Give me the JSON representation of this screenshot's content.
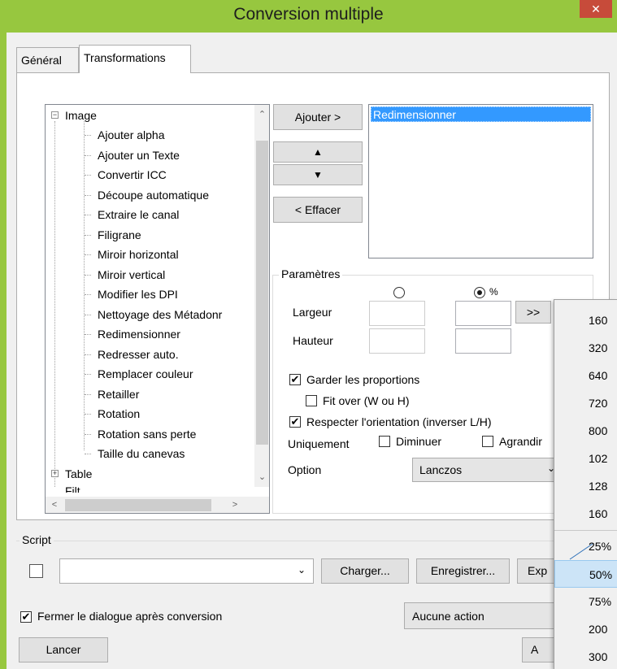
{
  "window": {
    "title": "Conversion multiple",
    "close": "✕"
  },
  "tabs": [
    {
      "label": "Général"
    },
    {
      "label": "Transformations"
    }
  ],
  "tree": {
    "root": "Image",
    "items": [
      "Ajouter alpha",
      "Ajouter un Texte",
      "Convertir ICC",
      "Découpe automatique",
      "Extraire le canal",
      "Filigrane",
      "Miroir horizontal",
      "Miroir vertical",
      "Modifier les DPI",
      "Nettoyage des Métadonr",
      "Redimensionner",
      "Redresser auto.",
      "Remplacer couleur",
      "Retailler",
      "Rotation",
      "Rotation sans perte",
      "Taille du canevas"
    ],
    "next_root": "Table",
    "partial_root": "Filt"
  },
  "buttons": {
    "ajouter": "Ajouter >",
    "up": "▲",
    "down": "▼",
    "effacer": "< Effacer",
    "more": ">>"
  },
  "selected_list": {
    "items": [
      "Redimensionner"
    ]
  },
  "parametres": {
    "title": "Paramètres",
    "percent_label": "%",
    "largeur": "Largeur",
    "hauteur": "Hauteur",
    "keep_ratio": "Garder les proportions",
    "fit_over": "Fit over (W ou H)",
    "orientation": "Respecter l'orientation (inverser L/H)",
    "uniquement": "Uniquement",
    "diminuer": "Diminuer",
    "agrandir": "Agrandir",
    "option": "Option",
    "option_value": "Lanczos"
  },
  "script": {
    "title": "Script",
    "charger": "Charger...",
    "enregistrer": "Enregistrer...",
    "export": "Exp"
  },
  "footer": {
    "fermer": "Fermer le dialogue après conversion",
    "action": "Aucune action",
    "lancer": "Lancer",
    "annuler_partial": "A"
  },
  "popup": {
    "items": [
      "160",
      "320",
      "640",
      "720",
      "800",
      "102",
      "128",
      "160"
    ],
    "percent_items": [
      "25%",
      "50%",
      "75%",
      "200",
      "300"
    ]
  },
  "colors": {
    "titlebar": "#97c73f",
    "close": "#c74b3a",
    "selection": "#3399ff"
  }
}
